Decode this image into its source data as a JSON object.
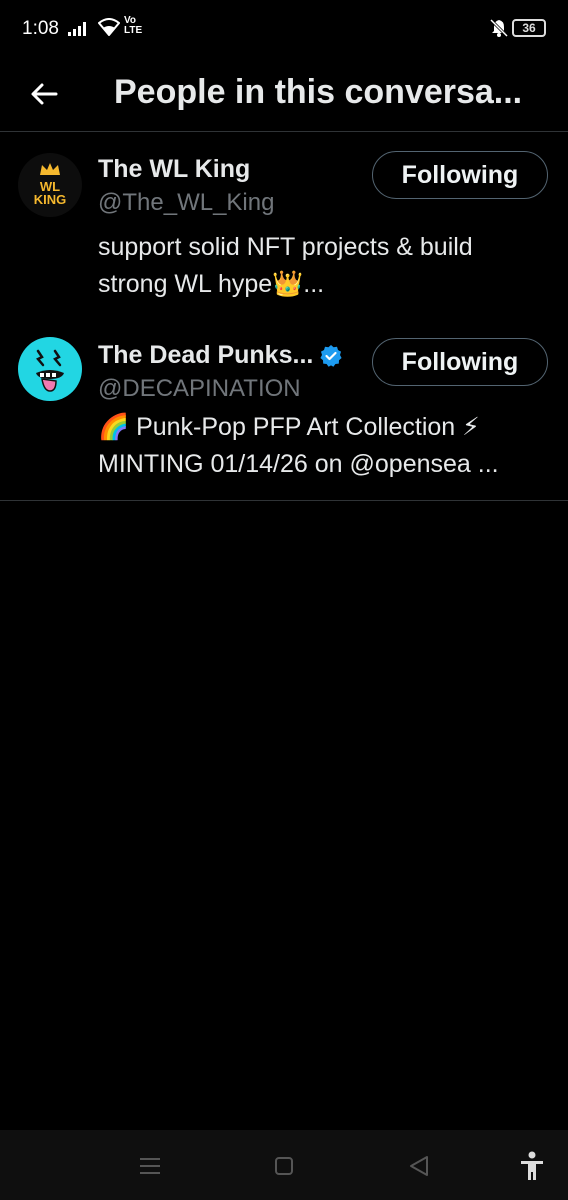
{
  "status_bar": {
    "time": "1:08",
    "network": "Vo\nLTE",
    "battery": "36"
  },
  "header": {
    "title": "People in this conversa..."
  },
  "users": [
    {
      "display_name": "The WL King",
      "handle": "@The_WL_King",
      "bio": "support solid NFT projects & build strong WL hype👑...",
      "follow_label": "Following",
      "avatar_text_1": "WL",
      "avatar_text_2": "KING",
      "verified": false
    },
    {
      "display_name": "The Dead Punks...",
      "handle": "@DECAPINATION",
      "bio": "🌈 Punk-Pop PFP Art Collection ⚡ MINTING 01/14/26 on @opensea ...",
      "follow_label": "Following",
      "verified": true
    }
  ],
  "colors": {
    "background": "#000000",
    "divider": "#2f3336",
    "secondary_text": "#71767b",
    "verified": "#1d9bf0",
    "avatar_2_bg": "#22d6e3",
    "crown": "#f5b82e"
  }
}
